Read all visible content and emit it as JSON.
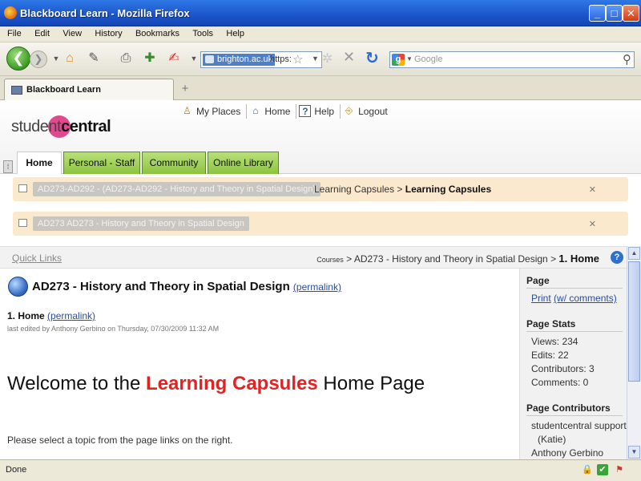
{
  "window": {
    "title": "Blackboard Learn - Mozilla Firefox",
    "minimize": "_",
    "maximize": "□",
    "close": "✕"
  },
  "menu": [
    "File",
    "Edit",
    "View",
    "History",
    "Bookmarks",
    "Tools",
    "Help"
  ],
  "nav": {
    "back_glyph": "❮",
    "forward_glyph": "❯",
    "url_site": "brighton.ac.uk",
    "url_scheme": "https:",
    "search_placeholder": "Google"
  },
  "tab": {
    "label": "Blackboard Learn",
    "new_tab": "+"
  },
  "header": {
    "top_links": [
      {
        "label": "My Places",
        "icon": "person-icon"
      },
      {
        "label": "Home",
        "icon": "house-icon"
      },
      {
        "label": "Help",
        "icon": "question-icon"
      },
      {
        "label": "Logout",
        "icon": "door-icon"
      }
    ],
    "logo_light": "student",
    "logo_bold": "central",
    "tabs": [
      "Home",
      "Personal - Staff",
      "Community",
      "Online Library"
    ]
  },
  "notices": [
    {
      "pill": "AD273-AD292 - (AD273-AD292 - History and Theory in Spatial Design)",
      "crumb_1": "Learning Capsules",
      "crumb_sep": ">",
      "crumb_2": "Learning Capsules"
    },
    {
      "pill": "AD273 AD273 - History and Theory in Spatial Design"
    }
  ],
  "quickbar": {
    "quick_links": "Quick Links",
    "courses": "Courses",
    "sep": ">",
    "course": "AD273 - History and Theory in Spatial Design",
    "current": "1. Home",
    "help": "?"
  },
  "content": {
    "title": "AD273 - History and Theory in Spatial Design",
    "permalink": "(permalink)",
    "sub_title": "1. Home",
    "sub_permalink": "(permalink)",
    "edited": "last edited by Anthony Gerbino on Thursday, 07/30/2009 11:32 AM",
    "welcome_pre": "Welcome to the",
    "welcome_highlight": "Learning Capsules",
    "welcome_post": "Home Page",
    "instruction": "Please select a topic from the page links on the right."
  },
  "sidebar": {
    "page_heading": "Page",
    "print": "Print",
    "print_comments": "(w/ comments)",
    "stats_heading": "Page Stats",
    "views": "Views: 234",
    "edits": "Edits: 22",
    "contributors": "Contributors: 3",
    "comments": "Comments: 0",
    "contributors_heading": "Page Contributors",
    "contrib_1": "studentcentral support",
    "contrib_1b": "(Katie)",
    "contrib_2": "Anthony Gerbino"
  },
  "status": {
    "text": "Done"
  },
  "colors": {
    "highlight_red": "#e32222",
    "tab_green": "#8cc43f",
    "notice_bg": "#fbe9cd",
    "logo_pink": "#e0498e"
  }
}
